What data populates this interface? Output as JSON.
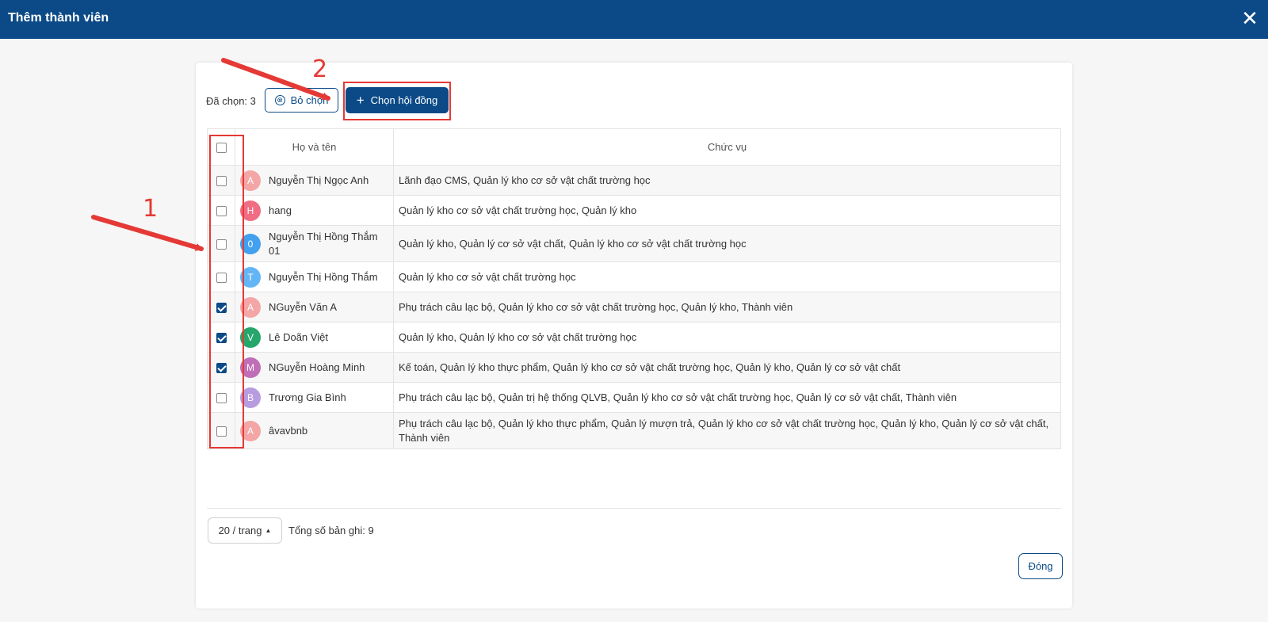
{
  "dialog": {
    "title": "Thêm thành viên",
    "close_symbol": "✕"
  },
  "toolbar": {
    "selected_label": "Đã chọn: 3",
    "deselect_label": "Bỏ chọn",
    "deselect_icon": "⊗",
    "council_plus": "+",
    "council_label": "Chọn hội đồng"
  },
  "table": {
    "headers": {
      "name": "Họ và tên",
      "role": "Chức vụ"
    },
    "rows": [
      {
        "initial": "A",
        "color": "#f4a5a5",
        "name": "Nguyễn Thị Ngọc Anh",
        "role": "Lãnh đạo CMS, Quản lý kho cơ sở vật chất trường học",
        "checked": false
      },
      {
        "initial": "H",
        "color": "#f06d84",
        "name": "hang",
        "role": "Quản lý kho cơ sở vật chất trường học, Quản lý kho",
        "checked": false
      },
      {
        "initial": "0",
        "color": "#42a0ef",
        "name": "Nguyễn Thị Hồng Thắm 01",
        "role": "Quản lý kho, Quản lý cơ sở vật chất, Quản lý kho cơ sở vật chất trường học",
        "checked": false
      },
      {
        "initial": "T",
        "color": "#64b5f6",
        "name": "Nguyễn Thị Hồng Thắm",
        "role": "Quản lý kho cơ sở vật chất trường học",
        "checked": false
      },
      {
        "initial": "A",
        "color": "#f4a5a5",
        "name": "NGuyễn Văn A",
        "role": "Phụ trách câu lạc bộ, Quản lý kho cơ sở vật chất trường học, Quản lý kho, Thành viên",
        "checked": true
      },
      {
        "initial": "V",
        "color": "#26a66a",
        "name": "Lê Doãn Việt",
        "role": "Quản lý kho, Quản lý kho cơ sở vật chất trường học",
        "checked": true
      },
      {
        "initial": "M",
        "color": "#c06fb6",
        "name": "NGuyễn Hoàng Minh",
        "role": "Kế toán, Quản lý kho thực phẩm, Quản lý kho cơ sở vật chất trường học, Quản lý kho, Quản lý cơ sở vật chất",
        "checked": true
      },
      {
        "initial": "B",
        "color": "#b89ce0",
        "name": "Trương Gia Bình",
        "role": "Phụ trách câu lạc bộ, Quản trị hệ thống QLVB, Quản lý kho cơ sở vật chất trường học, Quản lý cơ sở vật chất, Thành viên",
        "checked": false
      },
      {
        "initial": "A",
        "color": "#f4a5a5",
        "name": "âvavbnb",
        "role": "Phụ trách câu lạc bộ, Quản lý kho thực phẩm, Quản lý mượn trả, Quản lý kho cơ sở vật chất trường học, Quản lý kho, Quản lý cơ sở vật chất, Thành viên",
        "checked": false
      }
    ]
  },
  "footer": {
    "page_size": "20 / trang",
    "page_caret": "▲",
    "total_label": "Tổng số bản ghi: 9",
    "close_label": "Đóng"
  },
  "annotations": {
    "one": "1",
    "two": "2",
    "color": "#e53935"
  },
  "colors": {
    "primary": "#0b4a87",
    "annotation": "#e53935"
  }
}
